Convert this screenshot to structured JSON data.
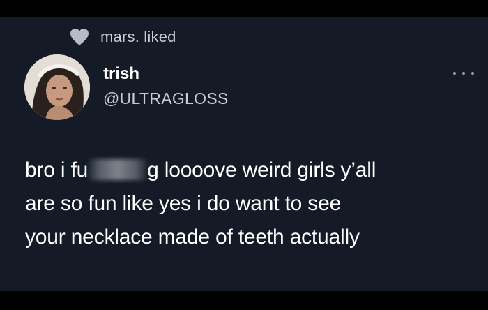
{
  "liked_by": {
    "icon": "heart-icon",
    "text": "mars. liked"
  },
  "author": {
    "name": "trish",
    "handle": "@ULTRAGLOSS",
    "avatar_icon": "avatar"
  },
  "menu": {
    "icon": "more-horizontal-icon"
  },
  "tweet": {
    "line1_before_censor": "bro i fu",
    "line1_after_censor": "g loooove weird girls y’all",
    "line2": "are so fun like yes i do want to see",
    "line3": "your necklace made of teeth actually"
  },
  "colors": {
    "background": "#141b26",
    "frame": "#000000",
    "primary_text": "#ffffff",
    "secondary_text": "#c9cdd3"
  }
}
